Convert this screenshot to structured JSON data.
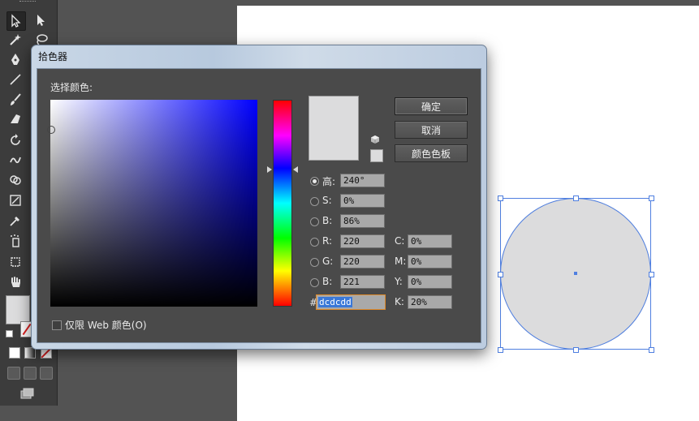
{
  "dialog": {
    "title": "拾色器",
    "select_color_label": "选择颜色:",
    "buttons": {
      "ok": "确定",
      "cancel": "取消",
      "swatches": "颜色色板"
    },
    "web_only_label": "仅限 Web 颜色(O)",
    "web_only_checked": false,
    "hsb": [
      {
        "label": "高:",
        "value": "240°",
        "selected": true
      },
      {
        "label": "S:",
        "value": "0%",
        "selected": false
      },
      {
        "label": "B:",
        "value": "86%",
        "selected": false
      }
    ],
    "rgb": [
      {
        "label": "R:",
        "value": "220"
      },
      {
        "label": "G:",
        "value": "220"
      },
      {
        "label": "B:",
        "value": "221"
      }
    ],
    "cmyk": [
      {
        "label": "C:",
        "value": "0%"
      },
      {
        "label": "M:",
        "value": "0%"
      },
      {
        "label": "Y:",
        "value": "0%"
      },
      {
        "label": "K:",
        "value": "20%"
      }
    ],
    "hex": {
      "label": "#",
      "value": "dcdcdd"
    },
    "current_color": "#dcdcdd",
    "hue_color": "#0000ff"
  },
  "canvas": {
    "shape": "circle",
    "fill": "#dcdcdd",
    "selection_color": "#4f7fe0"
  },
  "toolbar": {
    "tools": [
      "selection-tool",
      "direct-selection-tool",
      "magic-wand-tool",
      "lasso-tool",
      "pen-tool",
      "line-tool",
      "paintbrush-tool",
      "blob-brush-tool",
      "rotate-tool",
      "warp-tool",
      "shape-builder-tool",
      "free-transform-tool",
      "eyedropper-tool",
      "symbol-sprayer-tool",
      "artboard-tool",
      "hand-tool"
    ],
    "fill_color": "#dcdcdd"
  }
}
